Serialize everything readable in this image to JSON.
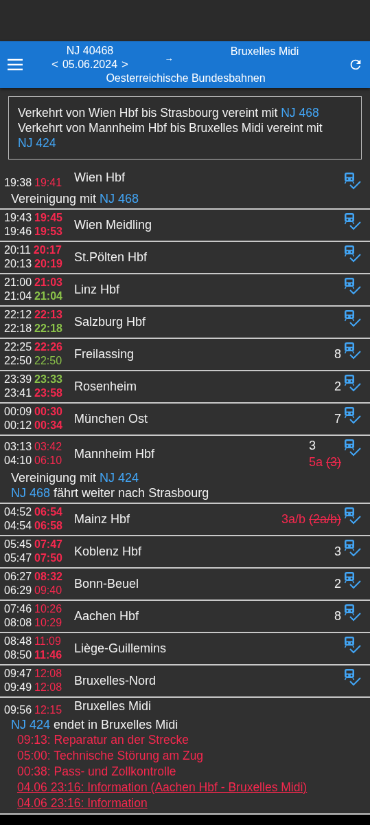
{
  "app_bar": {
    "train": "NJ 40468",
    "prev": "<",
    "date": "05.06.2024",
    "next": ">",
    "arrow": "→",
    "destination": "Bruxelles Midi",
    "operator": "Oesterreichische Bundesbahnen"
  },
  "info": [
    {
      "parts": [
        {
          "text": "Verkehrt von Wien Hbf bis Strasbourg vereint mit"
        },
        {
          "link": "NJ 468"
        }
      ]
    },
    {
      "parts": [
        {
          "text": "Verkehrt von Mannheim Hbf bis Bruxelles Midi vereint mit"
        },
        {
          "link": "NJ 424"
        }
      ]
    }
  ],
  "stops": [
    {
      "times": [
        {
          "scheduled": "19:38",
          "actual": "19:41",
          "color": "#f5284e",
          "bold": false
        }
      ],
      "station": "Wien Hbf",
      "tracked": true,
      "notes": [
        {
          "parts": [
            {
              "text": "Vereinigung mit"
            },
            {
              "link": "NJ 468"
            }
          ]
        }
      ]
    },
    {
      "times": [
        {
          "scheduled": "19:43",
          "actual": "19:45",
          "color": "#f5284e",
          "bold": true
        },
        {
          "scheduled": "19:46",
          "actual": "19:53",
          "color": "#f5284e",
          "bold": true
        }
      ],
      "station": "Wien Meidling",
      "tracked": true
    },
    {
      "times": [
        {
          "scheduled": "20:11",
          "actual": "20:17",
          "color": "#f5284e",
          "bold": true
        },
        {
          "scheduled": "20:13",
          "actual": "20:19",
          "color": "#f5284e",
          "bold": true
        }
      ],
      "station": "St.Pölten Hbf",
      "tracked": true
    },
    {
      "times": [
        {
          "scheduled": "21:00",
          "actual": "21:03",
          "color": "#f5284e",
          "bold": true
        },
        {
          "scheduled": "21:04",
          "actual": "21:04",
          "color": "#8bc34a",
          "bold": true
        }
      ],
      "station": "Linz Hbf",
      "tracked": true
    },
    {
      "times": [
        {
          "scheduled": "22:12",
          "actual": "22:13",
          "color": "#f5284e",
          "bold": true
        },
        {
          "scheduled": "22:18",
          "actual": "22:18",
          "color": "#8bc34a",
          "bold": true
        }
      ],
      "station": "Salzburg Hbf",
      "tracked": true
    },
    {
      "times": [
        {
          "scheduled": "22:25",
          "actual": "22:26",
          "color": "#f5284e",
          "bold": true
        },
        {
          "scheduled": "22:50",
          "actual": "22:50",
          "color": "#8bc34a",
          "bold": false
        }
      ],
      "station": "Freilassing",
      "platforms": [
        {
          "text": "8",
          "changed": false
        }
      ],
      "tracked": true
    },
    {
      "times": [
        {
          "scheduled": "23:39",
          "actual": "23:33",
          "color": "#8bc34a",
          "bold": true
        },
        {
          "scheduled": "23:41",
          "actual": "23:58",
          "color": "#f5284e",
          "bold": true
        }
      ],
      "station": "Rosenheim",
      "platforms": [
        {
          "text": "2",
          "changed": false
        }
      ],
      "tracked": true
    },
    {
      "times": [
        {
          "scheduled": "00:09",
          "actual": "00:30",
          "color": "#f5284e",
          "bold": true
        },
        {
          "scheduled": "00:12",
          "actual": "00:34",
          "color": "#f5284e",
          "bold": true
        }
      ],
      "station": "München Ost",
      "platforms": [
        {
          "text": "7",
          "changed": false
        }
      ],
      "tracked": true
    },
    {
      "times": [
        {
          "scheduled": "03:13",
          "actual": "03:42",
          "color": "#f5284e",
          "bold": false
        },
        {
          "scheduled": "04:10",
          "actual": "06:10",
          "color": "#f5284e",
          "bold": false
        }
      ],
      "station": "Mannheim Hbf",
      "platforms": [
        {
          "text": "3",
          "changed": false
        },
        {
          "text": "5a",
          "old": "(3)",
          "changed": true
        }
      ],
      "tracked": true,
      "notes": [
        {
          "parts": [
            {
              "text": "Vereinigung mit"
            },
            {
              "link": "NJ 424"
            }
          ]
        },
        {
          "parts": [
            {
              "link": "NJ 468"
            },
            {
              "text": "fährt weiter nach Strasbourg"
            }
          ]
        }
      ]
    },
    {
      "times": [
        {
          "scheduled": "04:52",
          "actual": "06:54",
          "color": "#f5284e",
          "bold": true
        },
        {
          "scheduled": "04:54",
          "actual": "06:58",
          "color": "#f5284e",
          "bold": true
        }
      ],
      "station": "Mainz Hbf",
      "platforms": [
        {
          "text": "3a/b",
          "old": "(2a/b)",
          "changed": true
        }
      ],
      "tracked": true
    },
    {
      "times": [
        {
          "scheduled": "05:45",
          "actual": "07:47",
          "color": "#f5284e",
          "bold": true
        },
        {
          "scheduled": "05:47",
          "actual": "07:50",
          "color": "#f5284e",
          "bold": true
        }
      ],
      "station": "Koblenz Hbf",
      "platforms": [
        {
          "text": "3",
          "changed": false
        }
      ],
      "tracked": true
    },
    {
      "times": [
        {
          "scheduled": "06:27",
          "actual": "08:32",
          "color": "#f5284e",
          "bold": true
        },
        {
          "scheduled": "06:29",
          "actual": "09:40",
          "color": "#f5284e",
          "bold": false
        }
      ],
      "station": "Bonn-Beuel",
      "platforms": [
        {
          "text": "2",
          "changed": false
        }
      ],
      "tracked": true
    },
    {
      "times": [
        {
          "scheduled": "07:46",
          "actual": "10:26",
          "color": "#f5284e",
          "bold": false
        },
        {
          "scheduled": "08:08",
          "actual": "10:29",
          "color": "#f5284e",
          "bold": false
        }
      ],
      "station": "Aachen Hbf",
      "platforms": [
        {
          "text": "8",
          "changed": false
        }
      ],
      "tracked": true
    },
    {
      "times": [
        {
          "scheduled": "08:48",
          "actual": "11:09",
          "color": "#f5284e",
          "bold": false
        },
        {
          "scheduled": "08:50",
          "actual": "11:46",
          "color": "#f5284e",
          "bold": true
        }
      ],
      "station": "Liège-Guillemins",
      "tracked": true
    },
    {
      "times": [
        {
          "scheduled": "09:47",
          "actual": "12:08",
          "color": "#f5284e",
          "bold": false
        },
        {
          "scheduled": "09:49",
          "actual": "12:08",
          "color": "#f5284e",
          "bold": false
        }
      ],
      "station": "Bruxelles-Nord",
      "tracked": true
    },
    {
      "times": [
        {
          "scheduled": "09:56",
          "actual": "12:15",
          "color": "#f5284e",
          "bold": false
        }
      ],
      "station": "Bruxelles Midi",
      "tracked": false,
      "notes": [
        {
          "parts": [
            {
              "link": "NJ 424"
            },
            {
              "text": "endet in Bruxelles Midi"
            }
          ]
        }
      ],
      "messages": [
        {
          "text": "09:13: Reparatur an der Strecke",
          "link": false
        },
        {
          "text": "05:00: Technische Störung am Zug",
          "link": false
        },
        {
          "text": "00:38: Pass- und Zollkontrolle",
          "link": false
        },
        {
          "text": "04.06 23:16: Information (Aachen Hbf - Bruxelles Midi)",
          "link": true
        },
        {
          "text": "04.06 23:16: Information",
          "link": true
        }
      ]
    }
  ]
}
